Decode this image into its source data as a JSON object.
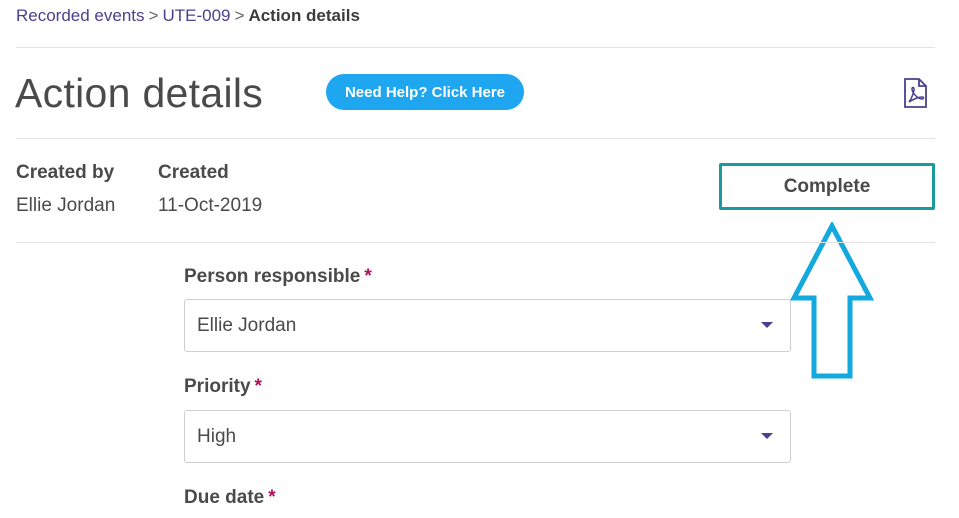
{
  "breadcrumb": {
    "item1": "Recorded events",
    "item2": "UTE-009",
    "current": "Action details",
    "separator": ">"
  },
  "header": {
    "title": "Action details",
    "help_button": "Need Help? Click Here",
    "pdf_icon": "pdf-icon"
  },
  "meta": {
    "created_by_label": "Created by",
    "created_by_value": "Ellie Jordan",
    "created_label": "Created",
    "created_value": "11-Oct-2019"
  },
  "actions": {
    "complete_label": "Complete"
  },
  "annotation": {
    "arrow_icon": "up-arrow-icon",
    "arrow_color": "#13a9df"
  },
  "form": {
    "person_responsible": {
      "label": "Person responsible",
      "required": "*",
      "value": "Ellie Jordan"
    },
    "priority": {
      "label": "Priority",
      "required": "*",
      "value": "High"
    },
    "due_date": {
      "label": "Due date",
      "required": "*"
    }
  },
  "colors": {
    "accent_blue": "#1ea7f0",
    "complete_border": "#1a9a9a",
    "required": "#b0105a",
    "link": "#4b3f8f"
  }
}
